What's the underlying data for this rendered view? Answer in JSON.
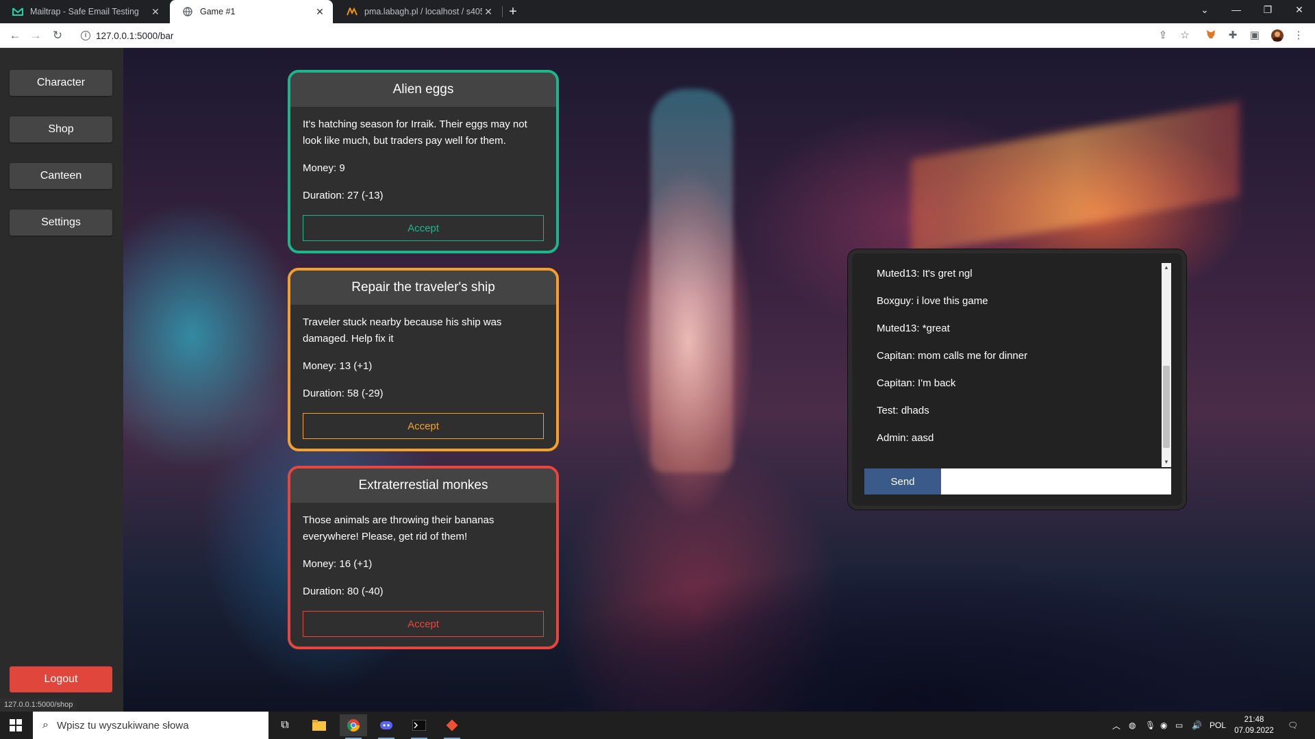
{
  "browser": {
    "tabs": [
      {
        "title": "Mailtrap - Safe Email Testing",
        "icon": "mailtrap-icon"
      },
      {
        "title": "Game #1",
        "icon": "globe-icon"
      },
      {
        "title": "pma.labagh.pl / localhost / s405",
        "icon": "phpmyadmin-icon"
      }
    ],
    "url": "127.0.0.1:5000/bar",
    "status_url": "127.0.0.1:5000/shop"
  },
  "sidebar": {
    "items": [
      {
        "label": "Character"
      },
      {
        "label": "Shop"
      },
      {
        "label": "Canteen"
      },
      {
        "label": "Settings"
      }
    ],
    "logout_label": "Logout"
  },
  "quests": [
    {
      "title": "Alien eggs",
      "description": "It's hatching season for Irraik. Their eggs may not look like much, but traders pay well for them.",
      "money": "Money: 9",
      "duration": "Duration: 27 (-13)",
      "accept_label": "Accept",
      "color": "#1eb58a"
    },
    {
      "title": "Repair the traveler's ship",
      "description": "Traveler stuck nearby because his ship was damaged. Help fix it",
      "money": "Money: 13 (+1)",
      "duration": "Duration: 58 (-29)",
      "accept_label": "Accept",
      "color": "#f3a12a"
    },
    {
      "title": "Extraterrestial monkes",
      "description": "Those animals are throwing their bananas everywhere! Please, get rid of them!",
      "money": "Money: 16 (+1)",
      "duration": "Duration: 80 (-40)",
      "accept_label": "Accept",
      "color": "#e6463f"
    }
  ],
  "chat": {
    "messages": [
      "Muted13: It's gret ngl",
      "Boxguy: i love this game",
      "Muted13: *great",
      "Capitan: mom calls me for dinner",
      "Capitan: I'm back",
      "Test: dhads",
      "Admin: aasd"
    ],
    "send_label": "Send",
    "input_value": ""
  },
  "taskbar": {
    "search_placeholder": "Wpisz tu wyszukiwane słowa",
    "language": "POL",
    "time": "21:48",
    "date": "07.09.2022"
  }
}
